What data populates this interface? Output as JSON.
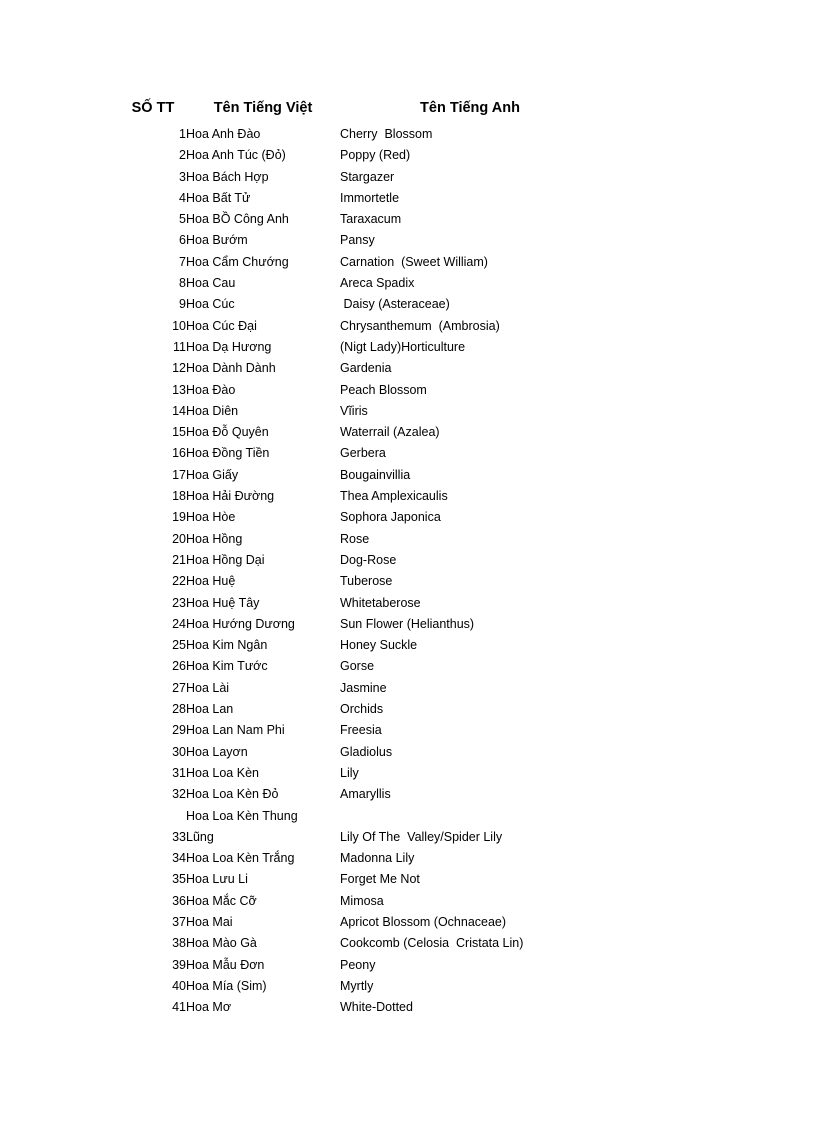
{
  "document": {
    "columns": {
      "index": "SỐ TT",
      "vietnamese": "Tên Tiếng Việt",
      "english": "Tên Tiếng Anh"
    },
    "rows": [
      {
        "no": "1",
        "vi": "Hoa Anh Đào",
        "en": "Cherry  Blossom"
      },
      {
        "no": "2",
        "vi": "Hoa Anh Túc (Đỏ)",
        "en": "Poppy (Red)"
      },
      {
        "no": "3",
        "vi": "Hoa Bách Hợp",
        "en": "Stargazer"
      },
      {
        "no": "4",
        "vi": "Hoa Bất Tử",
        "en": "Immortetle"
      },
      {
        "no": "5",
        "vi": "Hoa BỒ Công Anh",
        "en": "Taraxacum"
      },
      {
        "no": "6",
        "vi": "Hoa Bướm",
        "en": "Pansy"
      },
      {
        "no": "7",
        "vi": "Hoa Cẩm Chướng",
        "en": "Carnation  (Sweet William)"
      },
      {
        "no": "8",
        "vi": "Hoa Cau",
        "en": "Areca Spadix"
      },
      {
        "no": "9",
        "vi": "Hoa Cúc",
        "en": " Daisy (Asteraceae)"
      },
      {
        "no": "10",
        "vi": "Hoa Cúc Đại",
        "en": "Chrysanthemum  (Ambrosia)"
      },
      {
        "no": "11",
        "vi": "Hoa Dạ Hương",
        "en": "(Nigt Lady)Horticulture"
      },
      {
        "no": "12",
        "vi": "Hoa Dành Dành",
        "en": "Gardenia"
      },
      {
        "no": "13",
        "vi": "Hoa Đào",
        "en": "Peach Blossom"
      },
      {
        "no": "14",
        "vi": "Hoa Diên",
        "en": "Vĩiris"
      },
      {
        "no": "15",
        "vi": "Hoa Đỗ Quyên",
        "en": "Waterrail (Azalea)"
      },
      {
        "no": "16",
        "vi": "Hoa Đồng Tiền",
        "en": "Gerbera"
      },
      {
        "no": "17",
        "vi": "Hoa Giấy",
        "en": "Bougainvillia"
      },
      {
        "no": "18",
        "vi": "Hoa Hải Đường",
        "en": "Thea Amplexicaulis"
      },
      {
        "no": "19",
        "vi": "Hoa Hòe",
        "en": "Sophora Japonica"
      },
      {
        "no": "20",
        "vi": "Hoa Hồng",
        "en": "Rose"
      },
      {
        "no": "21",
        "vi": "Hoa Hồng Dại",
        "en": "Dog-Rose"
      },
      {
        "no": "22",
        "vi": "Hoa Huệ",
        "en": "Tuberose"
      },
      {
        "no": "23",
        "vi": "Hoa Huệ Tây",
        "en": "Whitetaberose"
      },
      {
        "no": "24",
        "vi": "Hoa Hướng Dương",
        "en": "Sun Flower (Helianthus)"
      },
      {
        "no": "25",
        "vi": "Hoa Kim Ngân",
        "en": "Honey Suckle"
      },
      {
        "no": "26",
        "vi": "Hoa Kim Tước",
        "en": "Gorse"
      },
      {
        "no": "27",
        "vi": "Hoa Lài",
        "en": "Jasmine"
      },
      {
        "no": "28",
        "vi": "Hoa Lan",
        "en": "Orchids"
      },
      {
        "no": "29",
        "vi": "Hoa Lan Nam Phi",
        "en": "Freesia"
      },
      {
        "no": "30",
        "vi": "Hoa Layơn",
        "en": "Gladiolus"
      },
      {
        "no": "31",
        "vi": "Hoa Loa Kèn",
        "en": "Lily"
      },
      {
        "no": "32",
        "vi": "Hoa Loa Kèn Đỏ",
        "en": "Amaryllis"
      },
      {
        "no": "33",
        "vi": "Hoa Loa Kèn Thung\nLũng",
        "en": "Lily Of The  Valley/Spider Lily",
        "wrap": true
      },
      {
        "no": "34",
        "vi": "Hoa Loa Kèn Trắng",
        "en": "Madonna Lily"
      },
      {
        "no": "35",
        "vi": "Hoa Lưu Li",
        "en": "Forget Me Not"
      },
      {
        "no": "36",
        "vi": "Hoa Mắc Cỡ",
        "en": "Mimosa"
      },
      {
        "no": "37",
        "vi": "Hoa Mai",
        "en": "Apricot Blossom (Ochnaceae)"
      },
      {
        "no": "38",
        "vi": "Hoa Mào Gà",
        "en": "Cookcomb (Celosia  Cristata Lin)"
      },
      {
        "no": "39",
        "vi": "Hoa Mẫu Đơn",
        "en": "Peony"
      },
      {
        "no": "40",
        "vi": "Hoa Mía (Sim)",
        "en": "Myrtly"
      },
      {
        "no": "41",
        "vi": "Hoa Mơ",
        "en": "White-Dotted"
      }
    ]
  }
}
